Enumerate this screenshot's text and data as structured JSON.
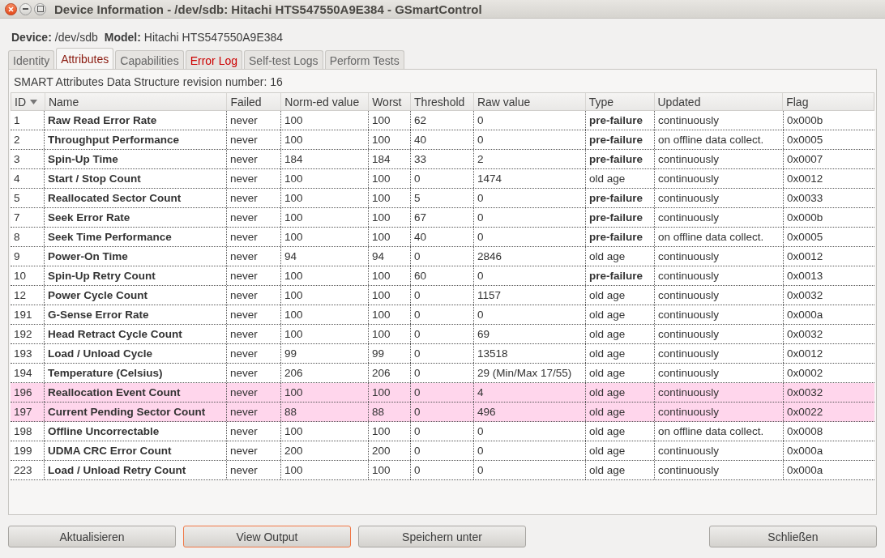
{
  "window": {
    "title": "Device Information - /dev/sdb: Hitachi HTS547550A9E384 - GSmartControl"
  },
  "device": {
    "device_label": "Device:",
    "device_value": "/dev/sdb",
    "model_label": "Model:",
    "model_value": "Hitachi HTS547550A9E384"
  },
  "tabs": [
    {
      "label": "Identity",
      "selected": false,
      "alert": false
    },
    {
      "label": "Attributes",
      "selected": true,
      "alert": false
    },
    {
      "label": "Capabilities",
      "selected": false,
      "alert": false
    },
    {
      "label": "Error Log",
      "selected": false,
      "alert": true
    },
    {
      "label": "Self-test Logs",
      "selected": false,
      "alert": false
    },
    {
      "label": "Perform Tests",
      "selected": false,
      "alert": false
    }
  ],
  "revision": "SMART Attributes Data Structure revision number: 16",
  "table": {
    "columns": [
      {
        "label": "ID",
        "sorted": true
      },
      {
        "label": "Name",
        "sorted": false
      },
      {
        "label": "Failed",
        "sorted": false
      },
      {
        "label": "Norm-ed value",
        "sorted": false
      },
      {
        "label": "Worst",
        "sorted": false
      },
      {
        "label": "Threshold",
        "sorted": false
      },
      {
        "label": "Raw value",
        "sorted": false
      },
      {
        "label": "Type",
        "sorted": false
      },
      {
        "label": "Updated",
        "sorted": false
      },
      {
        "label": "Flag",
        "sorted": false
      }
    ],
    "rows": [
      {
        "id": "1",
        "name": "Raw Read Error Rate",
        "failed": "never",
        "normed": "100",
        "worst": "100",
        "threshold": "62",
        "raw": "0",
        "type": "pre-failure",
        "prefailure": true,
        "updated": "continuously",
        "flag": "0x000b",
        "warning": false
      },
      {
        "id": "2",
        "name": "Throughput Performance",
        "failed": "never",
        "normed": "100",
        "worst": "100",
        "threshold": "40",
        "raw": "0",
        "type": "pre-failure",
        "prefailure": true,
        "updated": "on offline data collect.",
        "flag": "0x0005",
        "warning": false
      },
      {
        "id": "3",
        "name": "Spin-Up Time",
        "failed": "never",
        "normed": "184",
        "worst": "184",
        "threshold": "33",
        "raw": "2",
        "type": "pre-failure",
        "prefailure": true,
        "updated": "continuously",
        "flag": "0x0007",
        "warning": false
      },
      {
        "id": "4",
        "name": "Start / Stop Count",
        "failed": "never",
        "normed": "100",
        "worst": "100",
        "threshold": "0",
        "raw": "1474",
        "type": "old age",
        "prefailure": false,
        "updated": "continuously",
        "flag": "0x0012",
        "warning": false
      },
      {
        "id": "5",
        "name": "Reallocated Sector Count",
        "failed": "never",
        "normed": "100",
        "worst": "100",
        "threshold": "5",
        "raw": "0",
        "type": "pre-failure",
        "prefailure": true,
        "updated": "continuously",
        "flag": "0x0033",
        "warning": false
      },
      {
        "id": "7",
        "name": "Seek Error Rate",
        "failed": "never",
        "normed": "100",
        "worst": "100",
        "threshold": "67",
        "raw": "0",
        "type": "pre-failure",
        "prefailure": true,
        "updated": "continuously",
        "flag": "0x000b",
        "warning": false
      },
      {
        "id": "8",
        "name": "Seek Time Performance",
        "failed": "never",
        "normed": "100",
        "worst": "100",
        "threshold": "40",
        "raw": "0",
        "type": "pre-failure",
        "prefailure": true,
        "updated": "on offline data collect.",
        "flag": "0x0005",
        "warning": false
      },
      {
        "id": "9",
        "name": "Power-On Time",
        "failed": "never",
        "normed": "94",
        "worst": "94",
        "threshold": "0",
        "raw": "2846",
        "type": "old age",
        "prefailure": false,
        "updated": "continuously",
        "flag": "0x0012",
        "warning": false
      },
      {
        "id": "10",
        "name": "Spin-Up Retry Count",
        "failed": "never",
        "normed": "100",
        "worst": "100",
        "threshold": "60",
        "raw": "0",
        "type": "pre-failure",
        "prefailure": true,
        "updated": "continuously",
        "flag": "0x0013",
        "warning": false
      },
      {
        "id": "12",
        "name": "Power Cycle Count",
        "failed": "never",
        "normed": "100",
        "worst": "100",
        "threshold": "0",
        "raw": "1157",
        "type": "old age",
        "prefailure": false,
        "updated": "continuously",
        "flag": "0x0032",
        "warning": false
      },
      {
        "id": "191",
        "name": "G-Sense Error Rate",
        "failed": "never",
        "normed": "100",
        "worst": "100",
        "threshold": "0",
        "raw": "0",
        "type": "old age",
        "prefailure": false,
        "updated": "continuously",
        "flag": "0x000a",
        "warning": false
      },
      {
        "id": "192",
        "name": "Head Retract Cycle Count",
        "failed": "never",
        "normed": "100",
        "worst": "100",
        "threshold": "0",
        "raw": "69",
        "type": "old age",
        "prefailure": false,
        "updated": "continuously",
        "flag": "0x0032",
        "warning": false
      },
      {
        "id": "193",
        "name": "Load / Unload Cycle",
        "failed": "never",
        "normed": "99",
        "worst": "99",
        "threshold": "0",
        "raw": "13518",
        "type": "old age",
        "prefailure": false,
        "updated": "continuously",
        "flag": "0x0012",
        "warning": false
      },
      {
        "id": "194",
        "name": "Temperature (Celsius)",
        "failed": "never",
        "normed": "206",
        "worst": "206",
        "threshold": "0",
        "raw": "29 (Min/Max 17/55)",
        "type": "old age",
        "prefailure": false,
        "updated": "continuously",
        "flag": "0x0002",
        "warning": false
      },
      {
        "id": "196",
        "name": "Reallocation Event Count",
        "failed": "never",
        "normed": "100",
        "worst": "100",
        "threshold": "0",
        "raw": "4",
        "type": "old age",
        "prefailure": false,
        "updated": "continuously",
        "flag": "0x0032",
        "warning": true
      },
      {
        "id": "197",
        "name": "Current Pending Sector Count",
        "failed": "never",
        "normed": "88",
        "worst": "88",
        "threshold": "0",
        "raw": "496",
        "type": "old age",
        "prefailure": false,
        "updated": "continuously",
        "flag": "0x0022",
        "warning": true
      },
      {
        "id": "198",
        "name": "Offline Uncorrectable",
        "failed": "never",
        "normed": "100",
        "worst": "100",
        "threshold": "0",
        "raw": "0",
        "type": "old age",
        "prefailure": false,
        "updated": "on offline data collect.",
        "flag": "0x0008",
        "warning": false
      },
      {
        "id": "199",
        "name": "UDMA CRC Error Count",
        "failed": "never",
        "normed": "200",
        "worst": "200",
        "threshold": "0",
        "raw": "0",
        "type": "old age",
        "prefailure": false,
        "updated": "continuously",
        "flag": "0x000a",
        "warning": false
      },
      {
        "id": "223",
        "name": "Load / Unload Retry Count",
        "failed": "never",
        "normed": "100",
        "worst": "100",
        "threshold": "0",
        "raw": "0",
        "type": "old age",
        "prefailure": false,
        "updated": "continuously",
        "flag": "0x000a",
        "warning": false
      }
    ]
  },
  "buttons": [
    {
      "label": "Aktualisieren",
      "focused": false
    },
    {
      "label": "View Output",
      "focused": true
    },
    {
      "label": "Speichern unter",
      "focused": false
    },
    {
      "label": "Schließen",
      "focused": false
    }
  ]
}
